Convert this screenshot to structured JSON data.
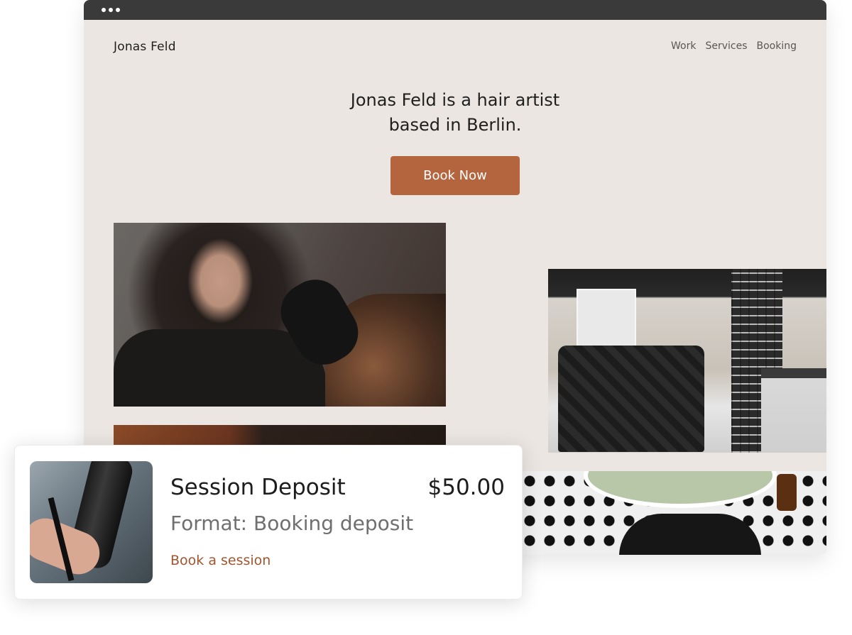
{
  "browser": {
    "window_dots": 3
  },
  "site": {
    "logo": "Jonas Feld",
    "nav": [
      "Work",
      "Services",
      "Booking"
    ],
    "hero_line1": "Jonas Feld is a hair artist",
    "hero_line2": "based in Berlin.",
    "cta_label": "Book Now"
  },
  "card": {
    "title": "Session Deposit",
    "price": "$50.00",
    "format": "Format: Booking deposit",
    "link": "Book a session"
  },
  "colors": {
    "page_background": "#ebe6e1",
    "accent": "#b5653d",
    "link": "#a4542d",
    "titlebar": "#3a3a3a"
  }
}
